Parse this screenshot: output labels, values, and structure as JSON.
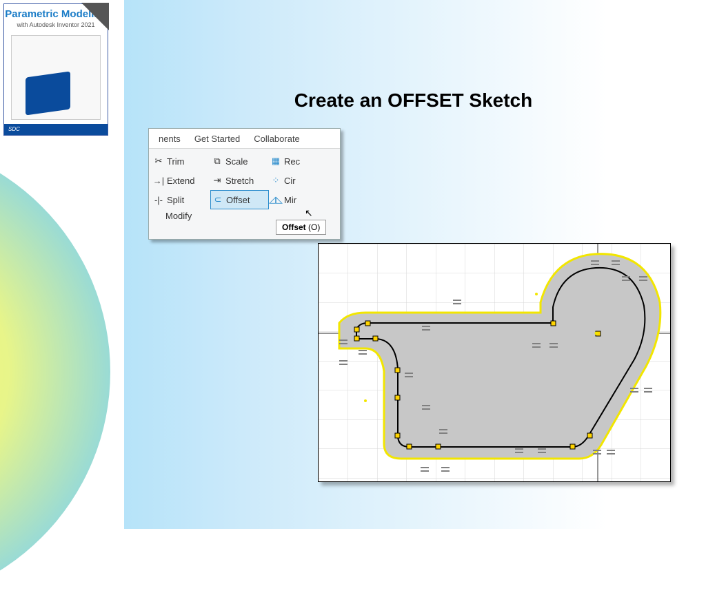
{
  "slide": {
    "title": "Create an OFFSET Sketch"
  },
  "book": {
    "title": "Parametric Modeling",
    "subtitle": "with Autodesk Inventor 2021",
    "publisher": "SDC"
  },
  "ribbon": {
    "tabs": {
      "partial_left": "nents",
      "get_started": "Get Started",
      "collaborate": "Collaborate"
    },
    "buttons": {
      "trim": "Trim",
      "scale": "Scale",
      "rectangular": "Rec",
      "extend": "Extend",
      "stretch": "Stretch",
      "circular": "Cir",
      "split": "Split",
      "offset": "Offset",
      "mirror": "Mir"
    },
    "panel_label": "Modify",
    "tooltip_label": "Offset",
    "tooltip_shortcut": "(O)"
  }
}
